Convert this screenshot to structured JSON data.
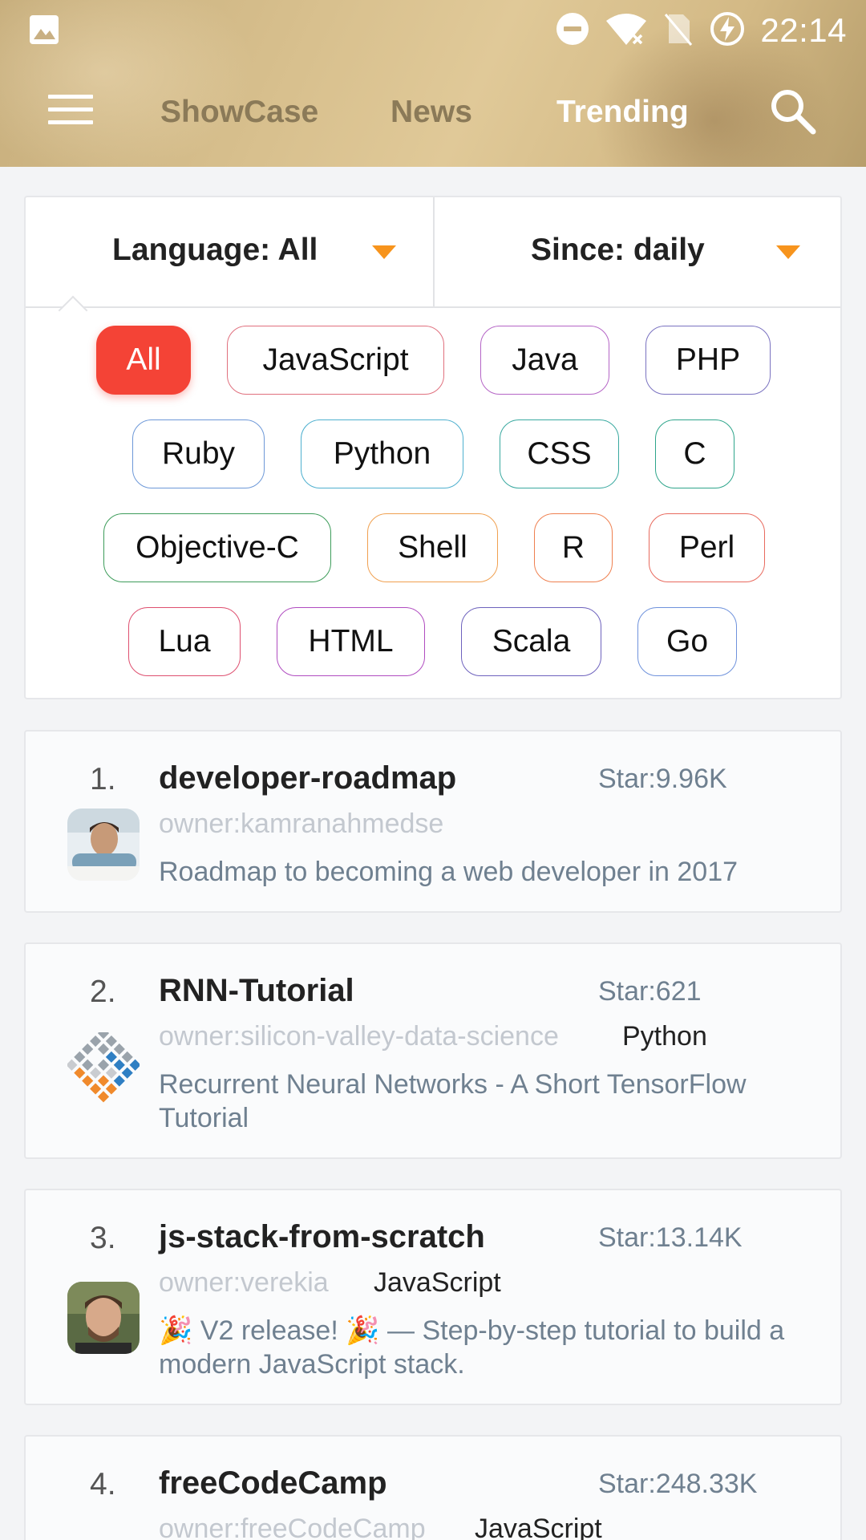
{
  "status_bar": {
    "time": "22:14",
    "icons": [
      "gallery-icon",
      "do-not-disturb-icon",
      "wifi-icon",
      "no-sim-icon",
      "battery-charging-icon"
    ]
  },
  "toolbar": {
    "menu_icon": "menu-icon",
    "tabs": [
      {
        "label": "ShowCase"
      },
      {
        "label": "News"
      },
      {
        "label": "Trending"
      }
    ],
    "selected_tab": "Trending",
    "search_icon": "search-icon"
  },
  "filters": {
    "language_label": "Language: All",
    "since_label": "Since: daily",
    "accent": "#f7941d"
  },
  "languages": [
    {
      "label": "All"
    },
    {
      "label": "JavaScript"
    },
    {
      "label": "Java"
    },
    {
      "label": "PHP"
    },
    {
      "label": "Ruby"
    },
    {
      "label": "Python"
    },
    {
      "label": "CSS"
    },
    {
      "label": "C"
    },
    {
      "label": "Objective-C"
    },
    {
      "label": "Shell"
    },
    {
      "label": "R"
    },
    {
      "label": "Perl"
    },
    {
      "label": "Lua"
    },
    {
      "label": "HTML"
    },
    {
      "label": "Scala"
    },
    {
      "label": "Go"
    }
  ],
  "selected_language": "All",
  "repos": [
    {
      "rank": "1.",
      "name": "developer-roadmap",
      "stars": "Star:9.96K",
      "owner": "owner:kamranahmedse",
      "language": "",
      "description": "Roadmap to becoming a web developer in 2017"
    },
    {
      "rank": "2.",
      "name": "RNN-Tutorial",
      "stars": "Star:621",
      "owner": "owner:silicon-valley-data-science",
      "language": "Python",
      "description": "Recurrent Neural Networks  - A Short TensorFlow Tutorial"
    },
    {
      "rank": "3.",
      "name": "js-stack-from-scratch",
      "stars": "Star:13.14K",
      "owner": "owner:verekia",
      "language": "JavaScript",
      "description": "🎉 V2 release! 🎉 — Step-by-step tutorial to build a modern JavaScript stack."
    },
    {
      "rank": "4.",
      "name": "freeCodeCamp",
      "stars": "Star:248.33K",
      "owner": "owner:freeCodeCamp",
      "language": "JavaScript",
      "description": ""
    }
  ]
}
